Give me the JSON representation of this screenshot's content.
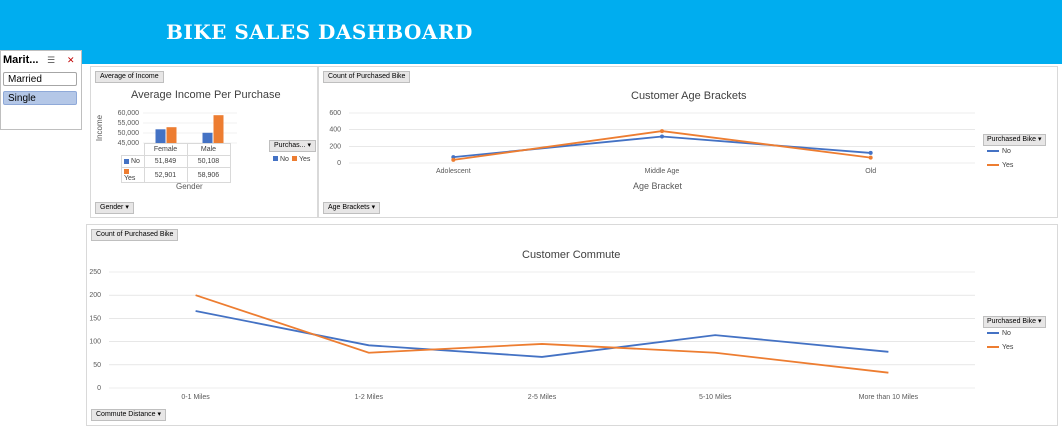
{
  "banner": {
    "title": "BIKE SALES DASHBOARD",
    "color": "#00adef"
  },
  "slicer": {
    "header": "Marit...",
    "items": [
      "Married",
      "Single"
    ],
    "selected": "Single"
  },
  "colors": {
    "no": "#4472c4",
    "yes": "#ed7d31"
  },
  "income_panel": {
    "field_button": "Average of Income",
    "title": "Average Income Per Purchase",
    "ylabel": "Income",
    "xlabel": "Gender",
    "axis_button": "Gender",
    "legend_button": "Purchas...",
    "legend_no": "No",
    "legend_yes": "Yes",
    "table": {
      "headers": [
        "Female",
        "Male"
      ],
      "rows": [
        {
          "label": "No",
          "values": [
            "51,849",
            "50,108"
          ]
        },
        {
          "label": "Yes",
          "values": [
            "52,901",
            "58,906"
          ]
        }
      ]
    }
  },
  "age_panel": {
    "field_button": "Count of Purchased Bike",
    "title": "Customer Age Brackets",
    "xlabel": "Age Bracket",
    "axis_button": "Age Brackets",
    "legend_button": "Purchased Bike",
    "legend_no": "No",
    "legend_yes": "Yes"
  },
  "commute_panel": {
    "field_button": "Count of Purchased Bike",
    "title": "Customer Commute",
    "axis_button": "Commute Distance",
    "legend_button": "Purchased Bike",
    "legend_no": "No",
    "legend_yes": "Yes"
  },
  "chart_data": [
    {
      "type": "bar",
      "title": "Average Income Per Purchase",
      "xlabel": "Gender",
      "ylabel": "Income",
      "categories": [
        "Female",
        "Male"
      ],
      "series": [
        {
          "name": "No",
          "values": [
            51849,
            50108
          ]
        },
        {
          "name": "Yes",
          "values": [
            52901,
            58906
          ]
        }
      ],
      "ylim": [
        45000,
        60000
      ],
      "yticks": [
        "60,000",
        "55,000",
        "50,000",
        "45,000"
      ]
    },
    {
      "type": "line",
      "title": "Customer Age Brackets",
      "xlabel": "Age Bracket",
      "categories": [
        "Adolescent",
        "Middle Age",
        "Old"
      ],
      "series": [
        {
          "name": "No",
          "values": [
            71,
            318,
            121
          ]
        },
        {
          "name": "Yes",
          "values": [
            38,
            383,
            65
          ]
        }
      ],
      "ylim": [
        0,
        600
      ],
      "yticks": [
        "600",
        "400",
        "200",
        "0"
      ]
    },
    {
      "type": "line",
      "title": "Customer Commute",
      "categories": [
        "0-1 Miles",
        "1-2 Miles",
        "2-5 Miles",
        "5-10 Miles",
        "More than 10 Miles"
      ],
      "series": [
        {
          "name": "No",
          "values": [
            166,
            92,
            67,
            114,
            78
          ]
        },
        {
          "name": "Yes",
          "values": [
            200,
            76,
            95,
            76,
            33
          ]
        }
      ],
      "ylim": [
        0,
        250
      ],
      "yticks": [
        "250",
        "200",
        "150",
        "100",
        "50",
        "0"
      ]
    }
  ]
}
